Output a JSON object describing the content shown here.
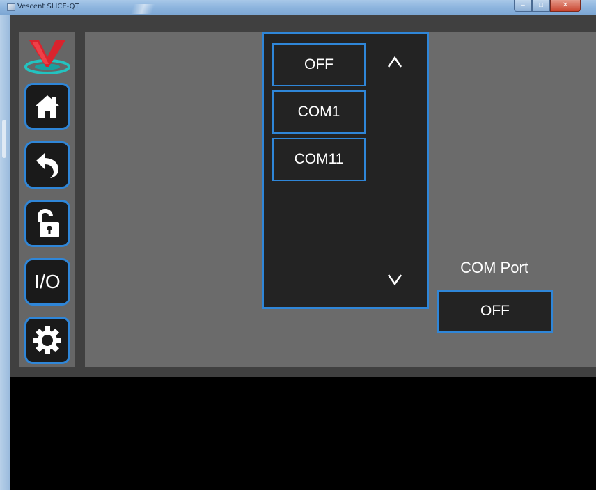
{
  "window": {
    "title": "Vescent SLICE-QT",
    "controls": [
      "minimize",
      "maximize",
      "close"
    ]
  },
  "sidebar": {
    "logo_icon": "vescent-logo-icon",
    "items": [
      {
        "id": "home",
        "icon": "home-icon"
      },
      {
        "id": "back",
        "icon": "back-arrow-icon"
      },
      {
        "id": "lock",
        "icon": "unlock-icon"
      },
      {
        "id": "io",
        "label": "I/O"
      },
      {
        "id": "settings",
        "icon": "gear-icon"
      }
    ]
  },
  "port_list": {
    "items": [
      "OFF",
      "COM1",
      "COM11"
    ],
    "scroll_up_label": "ʌ",
    "scroll_down_label": "v"
  },
  "com_port": {
    "label": "COM Port",
    "value": "OFF"
  },
  "colors": {
    "accent": "#2f86d8",
    "panel": "#6b6b6b",
    "button_bg": "#232323",
    "logo_red": "#d9232d",
    "logo_teal": "#23c3c0"
  }
}
